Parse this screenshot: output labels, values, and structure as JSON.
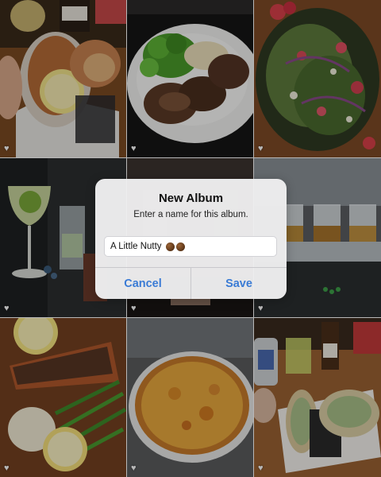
{
  "photos": [
    {
      "subject": "fried oysters with lemon on tray",
      "favorite_icon": "heart-icon"
    },
    {
      "subject": "steak with broccoli and mashed potatoes",
      "favorite_icon": "heart-icon"
    },
    {
      "subject": "green salad with strawberries",
      "favorite_icon": "heart-icon"
    },
    {
      "subject": "cocktail glass with garnish",
      "favorite_icon": "heart-icon"
    },
    {
      "subject": "bar counter",
      "favorite_icon": "heart-icon"
    },
    {
      "subject": "whiskey flight tasting board",
      "favorite_icon": "heart-icon"
    },
    {
      "subject": "salmon with green beans and lemon",
      "favorite_icon": "heart-icon"
    },
    {
      "subject": "cheese pizza",
      "favorite_icon": "heart-icon"
    },
    {
      "subject": "tacos with drinks",
      "favorite_icon": "heart-icon"
    }
  ],
  "dialog": {
    "title": "New Album",
    "message": "Enter a name for this album.",
    "input_value": "A Little Nutty",
    "input_emoji": "chestnut-emoji x2",
    "cancel_label": "Cancel",
    "save_label": "Save"
  },
  "colors": {
    "accent": "#3a7bd5",
    "dialog_bg": "#eeeef0"
  }
}
